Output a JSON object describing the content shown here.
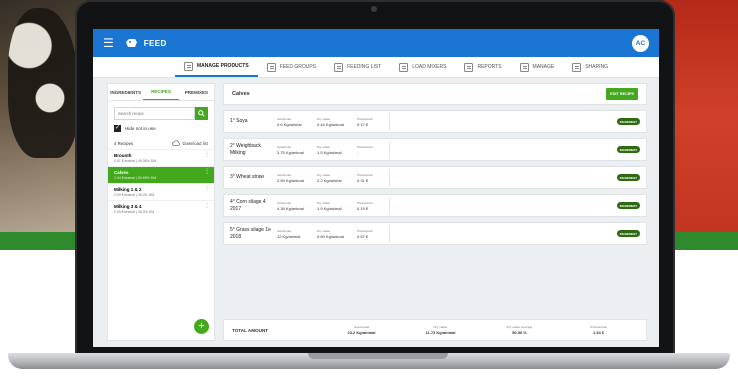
{
  "app": {
    "title": "FEED",
    "avatar": "AC"
  },
  "nav": [
    {
      "label": "MANAGE PRODUCTS",
      "icon": "manage-products-icon"
    },
    {
      "label": "FEED GROUPS",
      "icon": "feed-groups-icon"
    },
    {
      "label": "FEEDING LIST",
      "icon": "feeding-list-icon"
    },
    {
      "label": "LOAD MIXERS",
      "icon": "load-mixers-icon"
    },
    {
      "label": "REPORTS",
      "icon": "reports-icon"
    },
    {
      "label": "MANAGE",
      "icon": "manage-icon"
    },
    {
      "label": "SHARING",
      "icon": "sharing-icon"
    }
  ],
  "left": {
    "tabs": [
      "INGREDIENTS",
      "RECIPES",
      "PREMIXES"
    ],
    "search_placeholder": "Search recipe",
    "hide_label": "Hide not in use",
    "count_label": "4 Recipes",
    "download_label": "Download list",
    "recipes": [
      {
        "name": "Brounth",
        "sub": "0.61 €/animal | 49.08% DM"
      },
      {
        "name": "Calves",
        "sub": "1.04 €/animal | 50.69% DM"
      },
      {
        "name": "Milking 1 & 2",
        "sub": "0.09 €/animal | 36.0% DM"
      },
      {
        "name": "Milking 3 & 4",
        "sub": "0.09 €/animal | 36.0% DM"
      }
    ]
  },
  "right": {
    "title": "Calves",
    "edit_label": "EDIT RECIPE",
    "col_labels": {
      "actual": "Actual load",
      "dry": "Dry matter",
      "price": "Price/animal"
    },
    "badge": "INGREDIENT",
    "ingredients": [
      {
        "name": "1° Soya",
        "actual": "0.6 Kg/animal",
        "dry": "0.44 Kg/animal",
        "price": "9.17 €"
      },
      {
        "name": "2° Weighback Milking",
        "actual": "3.75 Kg/animal",
        "dry": "1.5 Kg/animal",
        "price": "-"
      },
      {
        "name": "3° Wheat straw",
        "actual": "2.59 Kg/animal",
        "dry": "2.2 Kg/animal",
        "price": "0.31 €"
      },
      {
        "name": "4° Corn silage 4 2017",
        "actual": "4.36 Kg/animal",
        "dry": "1.9 Kg/animal",
        "price": "0.19 €"
      },
      {
        "name": "5° Grass silage 1e 2018",
        "actual": "12 Kg/animal",
        "dry": "5.69 Kg/animal",
        "price": "0.57 €"
      }
    ],
    "total": {
      "label": "TOTAL AMOUNT",
      "actual_label": "Actual load",
      "actual": "23.2 Kg/animal",
      "dry_label": "Dry matter",
      "dry": "11.73 Kg/animal",
      "avg_label": "Dry matter average",
      "avg": "50.56 %",
      "price_label": "Price/animal",
      "price": "1.34 €"
    }
  },
  "colors": {
    "primary": "#1a76d2",
    "accent": "#43a81d",
    "badge": "#2d6a12"
  }
}
